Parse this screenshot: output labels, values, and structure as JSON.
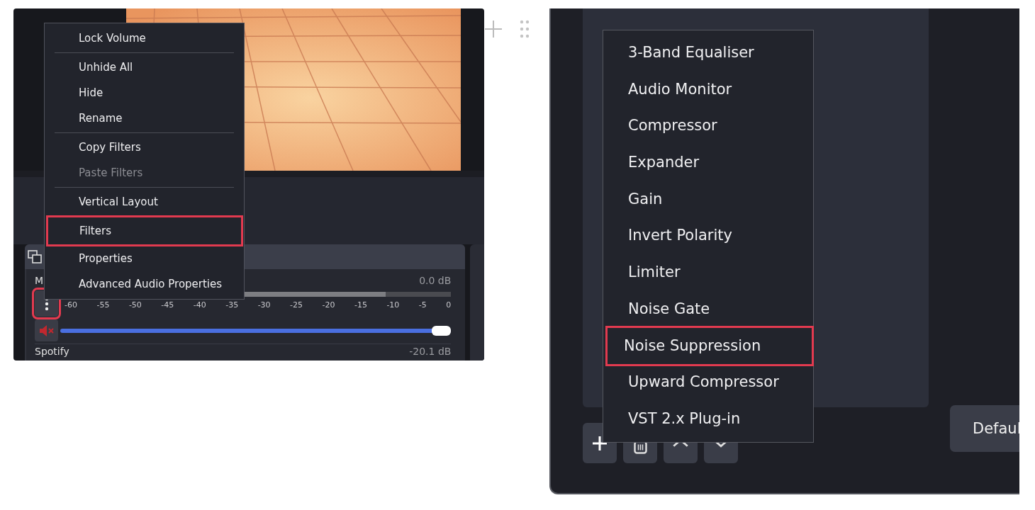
{
  "source_menu": {
    "groups": [
      [
        {
          "label": "Lock Volume",
          "disabled": false,
          "highlighted": false
        }
      ],
      [
        {
          "label": "Unhide All",
          "disabled": false,
          "highlighted": false
        },
        {
          "label": "Hide",
          "disabled": false,
          "highlighted": false
        },
        {
          "label": "Rename",
          "disabled": false,
          "highlighted": false
        }
      ],
      [
        {
          "label": "Copy Filters",
          "disabled": false,
          "highlighted": false
        },
        {
          "label": "Paste Filters",
          "disabled": true,
          "highlighted": false
        }
      ],
      [
        {
          "label": "Vertical Layout",
          "disabled": false,
          "highlighted": false
        },
        {
          "label": "Filters",
          "disabled": false,
          "highlighted": true
        },
        {
          "label": "Properties",
          "disabled": false,
          "highlighted": false
        },
        {
          "label": "Advanced Audio Properties",
          "disabled": false,
          "highlighted": false
        }
      ]
    ]
  },
  "mixer": {
    "channels": [
      {
        "name": "M",
        "reading": "0.0 dB",
        "menu_highlighted": true,
        "meter": {
          "level": 0.83
        },
        "scale": [
          "-60",
          "-55",
          "-50",
          "-45",
          "-40",
          "-35",
          "-30",
          "-25",
          "-20",
          "-15",
          "-10",
          "-5",
          "0"
        ],
        "muted": true,
        "volume": {
          "level": 1
        }
      },
      {
        "name": "Spotify",
        "reading": "-20.1 dB"
      }
    ]
  },
  "filter_menu": {
    "items": [
      {
        "label": "3-Band Equaliser",
        "highlighted": false
      },
      {
        "label": "Audio Monitor",
        "highlighted": false
      },
      {
        "label": "Compressor",
        "highlighted": false
      },
      {
        "label": "Expander",
        "highlighted": false
      },
      {
        "label": "Gain",
        "highlighted": false
      },
      {
        "label": "Invert Polarity",
        "highlighted": false
      },
      {
        "label": "Limiter",
        "highlighted": false
      },
      {
        "label": "Noise Gate",
        "highlighted": false
      },
      {
        "label": "Noise Suppression",
        "highlighted": true
      },
      {
        "label": "Upward Compressor",
        "highlighted": false
      },
      {
        "label": "VST 2.x Plug-in",
        "highlighted": false
      }
    ]
  },
  "defaults_button": "Defaul"
}
